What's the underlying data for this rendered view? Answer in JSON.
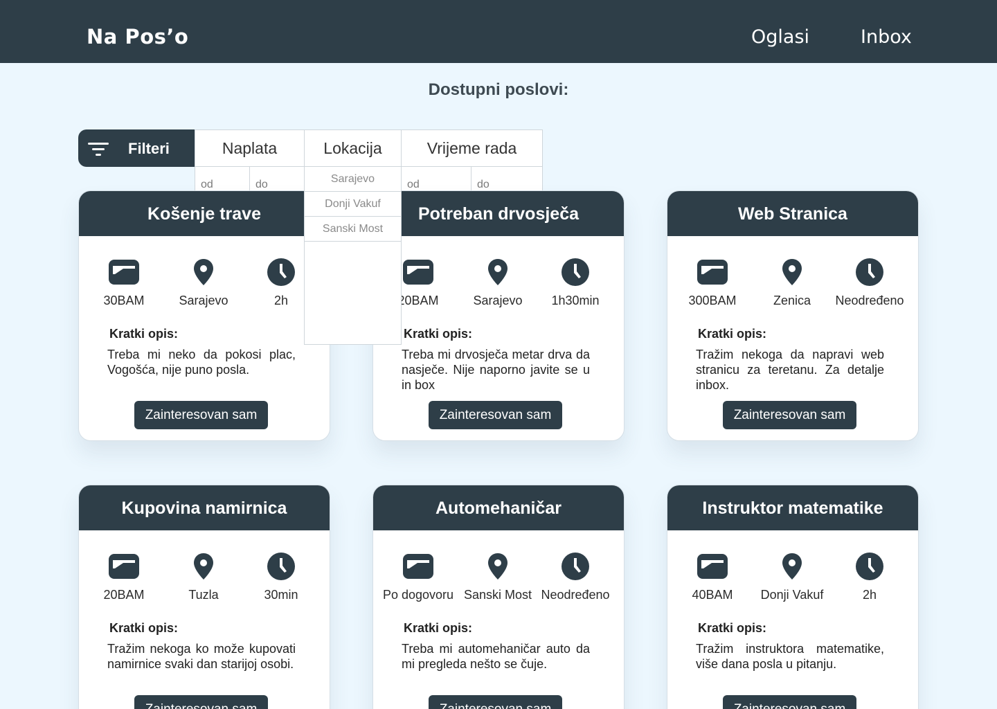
{
  "header": {
    "brand": "Na Pos’o",
    "nav": [
      "Oglasi",
      "Inbox"
    ]
  },
  "page_title": "Dostupni poslovi:",
  "filters": {
    "button_label": "Filteri",
    "tabs": [
      "Naplata",
      "Lokacija",
      "Vrijeme rada"
    ],
    "naplata": {
      "from_placeholder": "od",
      "to_placeholder": "do"
    },
    "lokacija_options": [
      "Sarajevo",
      "Donji Vakuf",
      "Sanski Most"
    ],
    "vrijeme": {
      "from_placeholder": "od",
      "to_placeholder": "do"
    }
  },
  "desc_label": "Kratki opis:",
  "cta_label": "Zainteresovan sam",
  "colors": {
    "header_bg": "#2e3e48",
    "page_bg": "#ecf7fe",
    "card_bg": "#ffffff"
  },
  "jobs": [
    {
      "title": "Košenje trave",
      "pay": "30BAM",
      "location": "Sarajevo",
      "time": "2h",
      "description": "Treba mi neko da pokosi plac, Vogošća, nije puno posla."
    },
    {
      "title": "Potreban drvosječa",
      "pay": "20BAM",
      "location": "Sarajevo",
      "time": "1h30min",
      "description": "Treba mi drvosječa metar drva da nasječe. Nije naporno javite se u in box"
    },
    {
      "title": "Web Stranica",
      "pay": "300BAM",
      "location": "Zenica",
      "time": "Neodređeno",
      "description": "Tražim nekoga da napravi web stranicu za teretanu. Za detalje inbox."
    },
    {
      "title": "Kupovina namirnica",
      "pay": "20BAM",
      "location": "Tuzla",
      "time": "30min",
      "description": "Tražim nekoga ko može kupovati namirnice svaki dan starijoj osobi."
    },
    {
      "title": "Automehaničar",
      "pay": "Po dogovoru",
      "location": "Sanski Most",
      "time": "Neodređeno",
      "description": "Treba mi automehaničar auto da mi pregleda nešto se čuje."
    },
    {
      "title": "Instruktor matematike",
      "pay": "40BAM",
      "location": "Donji Vakuf",
      "time": "2h",
      "description": "Tražim instruktora matematike, više dana posla u pitanju."
    }
  ]
}
